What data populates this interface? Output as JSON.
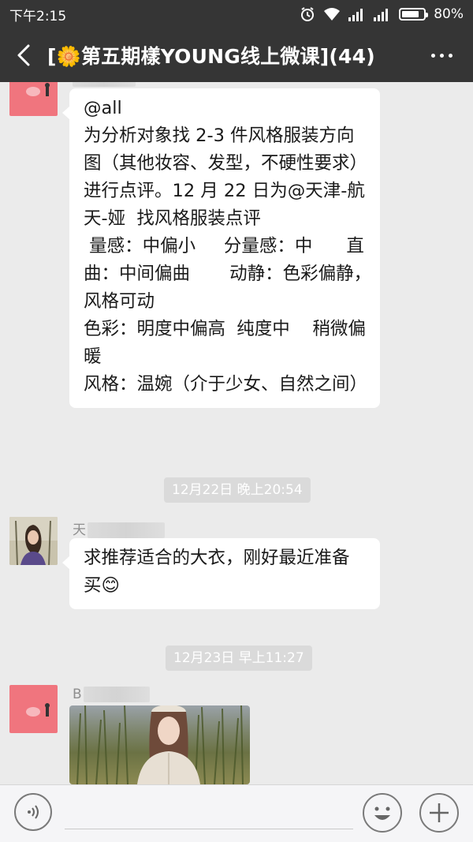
{
  "status_bar": {
    "time": "下午2:15",
    "battery": "80%",
    "battery_level": 0.8,
    "icons": [
      "alarm-icon",
      "wifi-icon",
      "signal-icon",
      "signal-icon",
      "battery-icon"
    ]
  },
  "nav": {
    "title": "[🌼第五期樣YOUNG线上微课](44)",
    "back_icon": "chevron-left-icon",
    "more_icon": "more-dots-icon"
  },
  "messages": [
    {
      "type": "text",
      "avatar": "avatar-pink-pig",
      "lines": [
        "@all",
        "为分析对象找 2-3 件风格服装方向",
        "图（其他妆容、发型，不硬性要求）",
        "进行点评。12 月 22 日为@天津-航",
        "天-娅  找风格服装点评",
        " 量感：中偏小     分量感：中      直",
        "曲：中间偏曲       动静：色彩偏静，",
        "风格可动",
        "色彩：明度中偏高  纯度中    稍微偏",
        "暖",
        "",
        "风格：温婉（介于少女、自然之间）"
      ]
    },
    {
      "type": "timestamp",
      "text": "12月22日 晚上20:54"
    },
    {
      "type": "text",
      "sender": "天",
      "avatar": "avatar-girl-photo",
      "lines": [
        "求推荐适合的大衣，刚好最近准备",
        "买😊"
      ]
    },
    {
      "type": "timestamp",
      "text": "12月23日 早上11:27"
    },
    {
      "type": "image",
      "sender": "B",
      "avatar": "avatar-pink-pig",
      "image": "woman-in-coat-photo"
    }
  ],
  "input_bar": {
    "placeholder": "",
    "voice_icon": "voice-icon",
    "emoji_icon": "emoji-icon",
    "plus_icon": "plus-icon"
  }
}
